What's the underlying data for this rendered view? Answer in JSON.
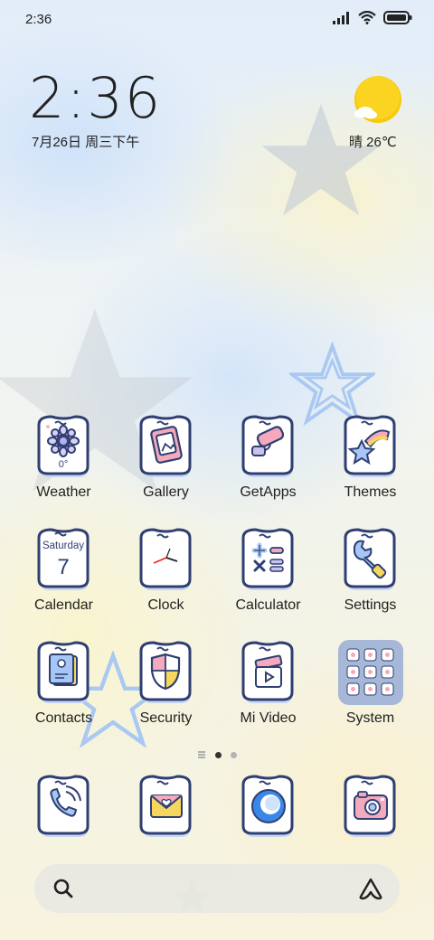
{
  "status_bar": {
    "time": "2:36",
    "icons": [
      "signal-icon",
      "wifi-icon",
      "battery-icon"
    ]
  },
  "clock_widget": {
    "time": "2:36",
    "date": "7月26日 周三下午",
    "weather": "晴 26℃",
    "weather_icon": "sun-cloud-icon"
  },
  "apps": [
    {
      "label": "Weather",
      "icon": "weather-icon",
      "sub": "0°"
    },
    {
      "label": "Gallery",
      "icon": "gallery-icon"
    },
    {
      "label": "GetApps",
      "icon": "getapps-icon"
    },
    {
      "label": "Themes",
      "icon": "themes-icon"
    },
    {
      "label": "Calendar",
      "icon": "calendar-icon",
      "sub_day": "Saturday",
      "sub_num": "7"
    },
    {
      "label": "Clock",
      "icon": "clock-icon"
    },
    {
      "label": "Calculator",
      "icon": "calculator-icon"
    },
    {
      "label": "Settings",
      "icon": "settings-icon"
    },
    {
      "label": "Contacts",
      "icon": "contacts-icon"
    },
    {
      "label": "Security",
      "icon": "security-icon"
    },
    {
      "label": "Mi Video",
      "icon": "mi-video-icon"
    },
    {
      "label": "System",
      "icon": "system-folder-icon"
    }
  ],
  "dock": [
    {
      "icon": "phone-icon"
    },
    {
      "icon": "messages-icon"
    },
    {
      "icon": "browser-icon"
    },
    {
      "icon": "camera-icon"
    }
  ],
  "page_indicator": {
    "pages": 2,
    "current": 1
  },
  "colors": {
    "icon_outline": "#2f3f72",
    "icon_fill": "#ffffff",
    "icon_shadow": "#c7d6f2",
    "folder_bg": "#a7b7d7",
    "sun": "#f6c90e"
  }
}
